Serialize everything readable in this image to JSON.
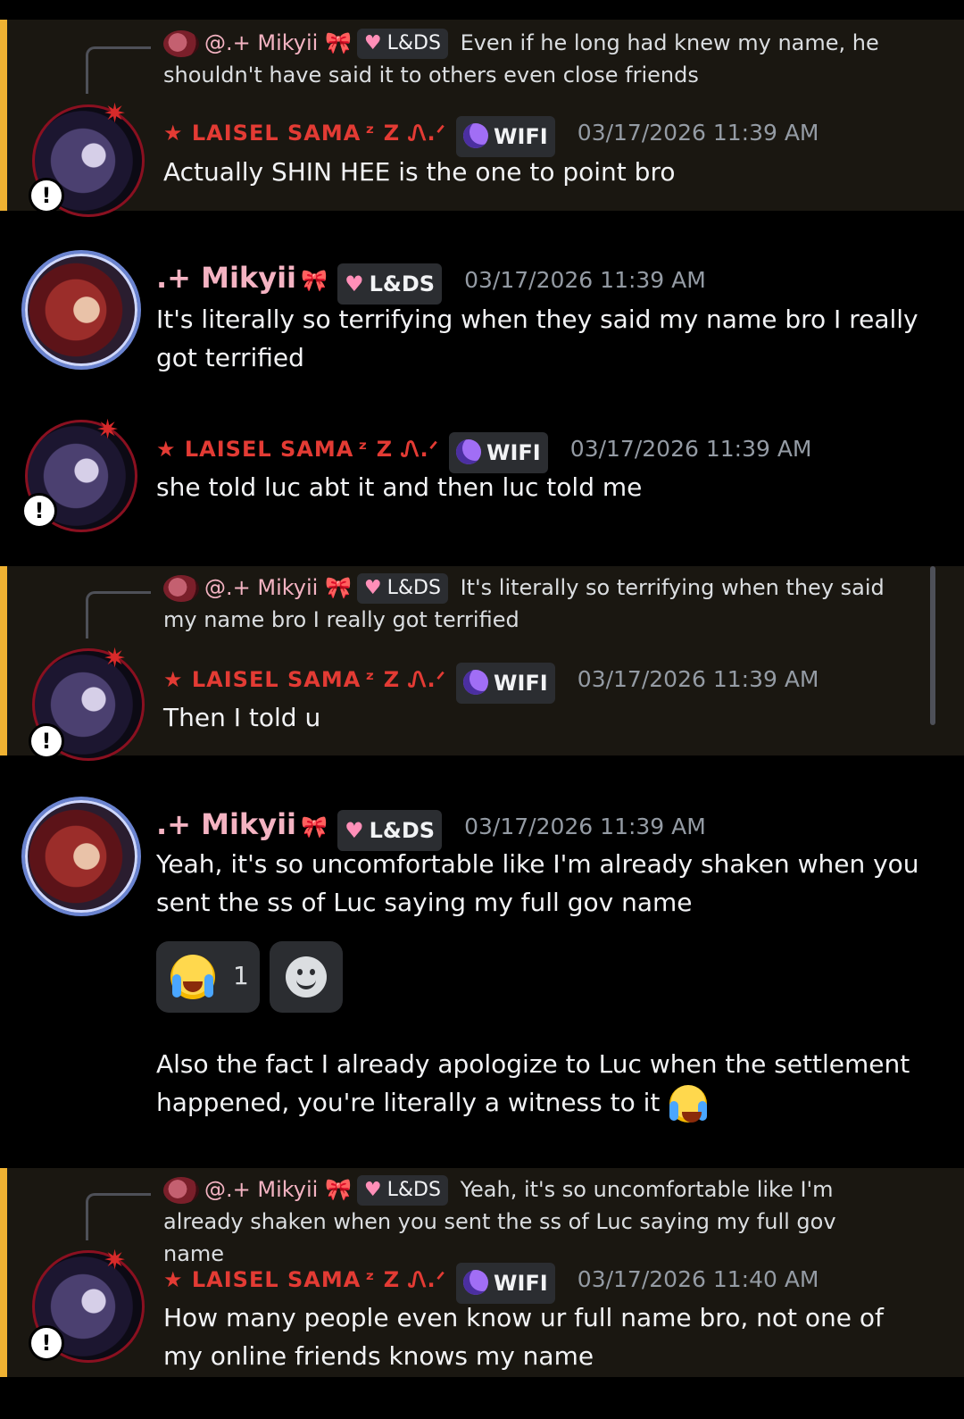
{
  "laisel": {
    "name": "★ LAISEL SAMA",
    "name_deco": "ᶻ Z Ꮑ.ᐟ",
    "tag": "WIFI",
    "tag_icon": "moon-icon"
  },
  "mikyii": {
    "name": ".+ Mikyii",
    "name_deco": "🎀",
    "reply_name": "@.+ Mikyii",
    "tag": "L&DS",
    "tag_icon": "heart-icon"
  },
  "messages": [
    {
      "reply_text": "Even if he long had knew my name, he shouldn't have said it to others even close friends",
      "timestamp": "03/17/2026 11:39 AM",
      "text": "Actually SHIN HEE is the one to point bro"
    },
    {
      "timestamp": "03/17/2026 11:39 AM",
      "text": "It's literally so terrifying when they said my name bro I really got terrified"
    },
    {
      "timestamp": "03/17/2026 11:39 AM",
      "text": "she told luc abt it and then luc told me"
    },
    {
      "reply_text": "It's literally so terrifying when they said my name bro I really got terrified",
      "timestamp": "03/17/2026 11:39 AM",
      "text": "Then I told u"
    },
    {
      "timestamp": "03/17/2026 11:39 AM",
      "text": "Yeah, it's so uncomfortable like I'm already shaken when you sent the ss of Luc saying my full gov name",
      "reaction_emoji": "loudly-crying-face",
      "reaction_count": "1",
      "followup": "Also the fact I already apologize to Luc when the settlement happened, you're literally a witness to it"
    },
    {
      "reply_text": "Yeah, it's so uncomfortable like I'm already shaken when you sent the ss of Luc saying my full gov name",
      "timestamp": "03/17/2026 11:40 AM",
      "text": "How many people even know ur full name bro, not one of my online friends knows my name"
    }
  ],
  "colors": {
    "mention_highlight": "#1a1711",
    "mention_bar": "#f0b232",
    "laisel_name": "#e33b34",
    "mikyii_name": "#f4b3c2",
    "timestamp": "#949ba4"
  }
}
